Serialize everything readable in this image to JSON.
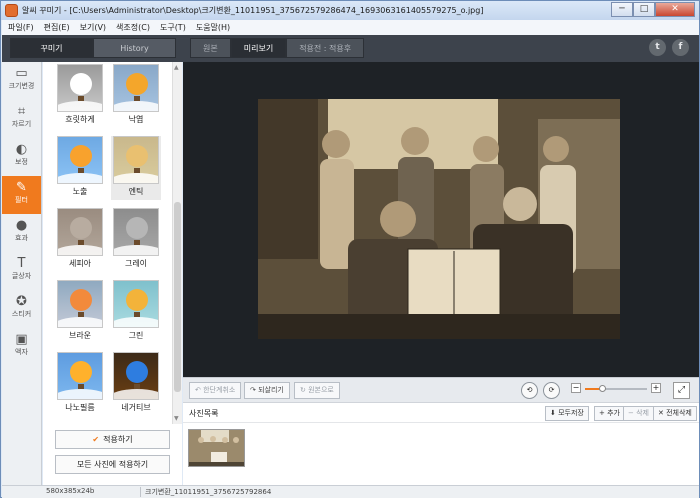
{
  "window": {
    "title": "알씨 꾸미기 - [C:\\Users\\Administrator\\Desktop\\크기변환_11011951_375672579286474_1693063161405579275_o.jpg]",
    "min": "─",
    "max": "□",
    "close": "✕"
  },
  "menu": [
    "파일(F)",
    "편집(E)",
    "보기(V)",
    "색조정(C)",
    "도구(T)",
    "도움말(H)"
  ],
  "mode_tabs": [
    "꾸미기",
    "History"
  ],
  "view_tabs": [
    "원본",
    "미리보기",
    "적용전 : 적용후"
  ],
  "social": {
    "twitter": "t",
    "facebook": "f"
  },
  "left_nav": [
    {
      "label": "크기변경",
      "icon": "resize-icon",
      "glyph": "▭"
    },
    {
      "label": "자르기",
      "icon": "crop-icon",
      "glyph": "⌗"
    },
    {
      "label": "보정",
      "icon": "adjust-icon",
      "glyph": "◐"
    },
    {
      "label": "필터",
      "icon": "filter-brush-icon",
      "glyph": "✎"
    },
    {
      "label": "효과",
      "icon": "drop-icon",
      "glyph": "●"
    },
    {
      "label": "글상자",
      "icon": "text-icon",
      "glyph": "T"
    },
    {
      "label": "스티커",
      "icon": "sticker-icon",
      "glyph": "✪"
    },
    {
      "label": "액자",
      "icon": "frame-icon",
      "glyph": "▣"
    }
  ],
  "filters": [
    {
      "label": "흐릿하게",
      "tint": "#9a9a9a",
      "balloon": "#ffffff",
      "sky": "#c9c9c9"
    },
    {
      "label": "낙엽",
      "tint": "#89a8c8",
      "balloon": "#f4a62b",
      "sky": "#a6c3e0"
    },
    {
      "label": "노출",
      "tint": "#6ea9e3",
      "balloon": "#f8a22d",
      "sky": "#8cc3f5"
    },
    {
      "label": "엔틱",
      "tint": "#c9b88c",
      "balloon": "#e9c070",
      "sky": "#d9cc9e"
    },
    {
      "label": "세피아",
      "tint": "#9a8c80",
      "balloon": "#b8aca0",
      "sky": "#b2a69a"
    },
    {
      "label": "그레이",
      "tint": "#8d8d8d",
      "balloon": "#b6b6b6",
      "sky": "#a7a7a7"
    },
    {
      "label": "브라운",
      "tint": "#8fa9c0",
      "balloon": "#f28a3c",
      "sky": "#c3c9d6"
    },
    {
      "label": "그린",
      "tint": "#7fc0cc",
      "balloon": "#f3b33a",
      "sky": "#a9dbe0"
    },
    {
      "label": "나노필름",
      "tint": "#5e9ce0",
      "balloon": "#ffb12c",
      "sky": "#7db7ee"
    },
    {
      "label": "네거티브",
      "tint": "#3c2a18",
      "balloon": "#2e7de0",
      "sky": "#6b3e12"
    }
  ],
  "selected_filter": "엔틱",
  "buttons": {
    "apply": "적용하기",
    "apply_all": "모든 사진에 적용하기",
    "apply_check": "✔"
  },
  "controls": {
    "undo": "한단계취소",
    "redo": "되살리기",
    "revert": "원본으로",
    "rotate_left": "⟲",
    "rotate_right": "⟳",
    "zoom_out": "−",
    "zoom_in": "+",
    "fit": "⤢",
    "zoom_level": 0.28
  },
  "photo_list": {
    "title": "사진목록",
    "save_all": "모두저장",
    "add": "추가",
    "delete": "삭제",
    "delete_all": "전체삭제"
  },
  "status": {
    "size": "580x385x24b",
    "filename": "크기변환_11011951_3756725792864"
  },
  "colors": {
    "accent": "#f07a1e",
    "dark": "#3d434c"
  }
}
